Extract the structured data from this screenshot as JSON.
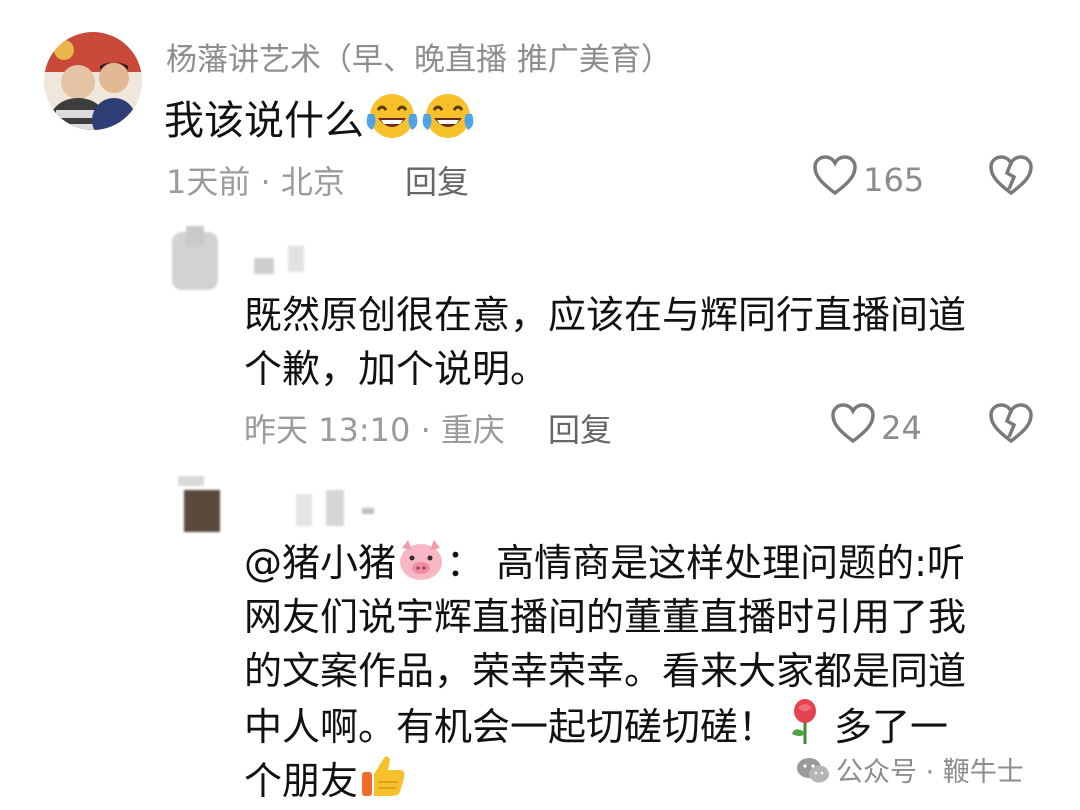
{
  "comment": {
    "username": "杨藩讲艺术（早、晚直播 推广美育）",
    "text": "我该说什么",
    "time": "1天前",
    "location": "· 北京",
    "reply_label": "回复",
    "likes": "165"
  },
  "replies": [
    {
      "lines": [
        "既然原创很在意，应该在与辉同行直播间道",
        "个歉，加个说明。"
      ],
      "time": "昨天 13:10",
      "location": "· 重庆",
      "reply_label": "回复",
      "likes": "24"
    },
    {
      "mention": "@猪小猪",
      "line1_rest": "： 高情商是这样处理问题的:听",
      "line2": "网友们说宇辉直播间的董董直播时引用了我",
      "line3": "的文案作品，荣幸荣幸。看来大家都是同道",
      "line4_a": "中人啊。有机会一起切磋切磋！",
      "line4_b": "多了一",
      "line5": "个朋友"
    }
  ],
  "watermark": {
    "text": "公众号 · 鞭牛士"
  },
  "icons": {
    "like": "heart-outline-icon",
    "dislike": "broken-heart-icon",
    "laugh": "laughing-tears-emoji",
    "pig": "pig-face-emoji",
    "rose": "rose-emoji",
    "thumb": "thumbs-up-emoji",
    "wechat": "wechat-icon"
  }
}
